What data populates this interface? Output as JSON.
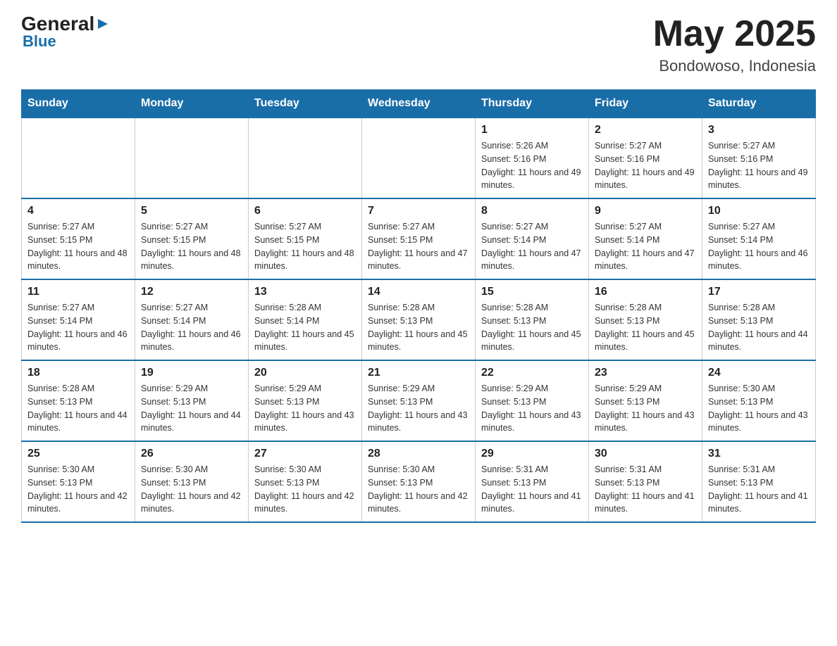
{
  "header": {
    "logo_general": "General",
    "logo_blue": "Blue",
    "month_year": "May 2025",
    "location": "Bondowoso, Indonesia"
  },
  "weekdays": [
    "Sunday",
    "Monday",
    "Tuesday",
    "Wednesday",
    "Thursday",
    "Friday",
    "Saturday"
  ],
  "weeks": [
    [
      {
        "day": "",
        "sunrise": "",
        "sunset": "",
        "daylight": ""
      },
      {
        "day": "",
        "sunrise": "",
        "sunset": "",
        "daylight": ""
      },
      {
        "day": "",
        "sunrise": "",
        "sunset": "",
        "daylight": ""
      },
      {
        "day": "",
        "sunrise": "",
        "sunset": "",
        "daylight": ""
      },
      {
        "day": "1",
        "sunrise": "Sunrise: 5:26 AM",
        "sunset": "Sunset: 5:16 PM",
        "daylight": "Daylight: 11 hours and 49 minutes."
      },
      {
        "day": "2",
        "sunrise": "Sunrise: 5:27 AM",
        "sunset": "Sunset: 5:16 PM",
        "daylight": "Daylight: 11 hours and 49 minutes."
      },
      {
        "day": "3",
        "sunrise": "Sunrise: 5:27 AM",
        "sunset": "Sunset: 5:16 PM",
        "daylight": "Daylight: 11 hours and 49 minutes."
      }
    ],
    [
      {
        "day": "4",
        "sunrise": "Sunrise: 5:27 AM",
        "sunset": "Sunset: 5:15 PM",
        "daylight": "Daylight: 11 hours and 48 minutes."
      },
      {
        "day": "5",
        "sunrise": "Sunrise: 5:27 AM",
        "sunset": "Sunset: 5:15 PM",
        "daylight": "Daylight: 11 hours and 48 minutes."
      },
      {
        "day": "6",
        "sunrise": "Sunrise: 5:27 AM",
        "sunset": "Sunset: 5:15 PM",
        "daylight": "Daylight: 11 hours and 48 minutes."
      },
      {
        "day": "7",
        "sunrise": "Sunrise: 5:27 AM",
        "sunset": "Sunset: 5:15 PM",
        "daylight": "Daylight: 11 hours and 47 minutes."
      },
      {
        "day": "8",
        "sunrise": "Sunrise: 5:27 AM",
        "sunset": "Sunset: 5:14 PM",
        "daylight": "Daylight: 11 hours and 47 minutes."
      },
      {
        "day": "9",
        "sunrise": "Sunrise: 5:27 AM",
        "sunset": "Sunset: 5:14 PM",
        "daylight": "Daylight: 11 hours and 47 minutes."
      },
      {
        "day": "10",
        "sunrise": "Sunrise: 5:27 AM",
        "sunset": "Sunset: 5:14 PM",
        "daylight": "Daylight: 11 hours and 46 minutes."
      }
    ],
    [
      {
        "day": "11",
        "sunrise": "Sunrise: 5:27 AM",
        "sunset": "Sunset: 5:14 PM",
        "daylight": "Daylight: 11 hours and 46 minutes."
      },
      {
        "day": "12",
        "sunrise": "Sunrise: 5:27 AM",
        "sunset": "Sunset: 5:14 PM",
        "daylight": "Daylight: 11 hours and 46 minutes."
      },
      {
        "day": "13",
        "sunrise": "Sunrise: 5:28 AM",
        "sunset": "Sunset: 5:14 PM",
        "daylight": "Daylight: 11 hours and 45 minutes."
      },
      {
        "day": "14",
        "sunrise": "Sunrise: 5:28 AM",
        "sunset": "Sunset: 5:13 PM",
        "daylight": "Daylight: 11 hours and 45 minutes."
      },
      {
        "day": "15",
        "sunrise": "Sunrise: 5:28 AM",
        "sunset": "Sunset: 5:13 PM",
        "daylight": "Daylight: 11 hours and 45 minutes."
      },
      {
        "day": "16",
        "sunrise": "Sunrise: 5:28 AM",
        "sunset": "Sunset: 5:13 PM",
        "daylight": "Daylight: 11 hours and 45 minutes."
      },
      {
        "day": "17",
        "sunrise": "Sunrise: 5:28 AM",
        "sunset": "Sunset: 5:13 PM",
        "daylight": "Daylight: 11 hours and 44 minutes."
      }
    ],
    [
      {
        "day": "18",
        "sunrise": "Sunrise: 5:28 AM",
        "sunset": "Sunset: 5:13 PM",
        "daylight": "Daylight: 11 hours and 44 minutes."
      },
      {
        "day": "19",
        "sunrise": "Sunrise: 5:29 AM",
        "sunset": "Sunset: 5:13 PM",
        "daylight": "Daylight: 11 hours and 44 minutes."
      },
      {
        "day": "20",
        "sunrise": "Sunrise: 5:29 AM",
        "sunset": "Sunset: 5:13 PM",
        "daylight": "Daylight: 11 hours and 43 minutes."
      },
      {
        "day": "21",
        "sunrise": "Sunrise: 5:29 AM",
        "sunset": "Sunset: 5:13 PM",
        "daylight": "Daylight: 11 hours and 43 minutes."
      },
      {
        "day": "22",
        "sunrise": "Sunrise: 5:29 AM",
        "sunset": "Sunset: 5:13 PM",
        "daylight": "Daylight: 11 hours and 43 minutes."
      },
      {
        "day": "23",
        "sunrise": "Sunrise: 5:29 AM",
        "sunset": "Sunset: 5:13 PM",
        "daylight": "Daylight: 11 hours and 43 minutes."
      },
      {
        "day": "24",
        "sunrise": "Sunrise: 5:30 AM",
        "sunset": "Sunset: 5:13 PM",
        "daylight": "Daylight: 11 hours and 43 minutes."
      }
    ],
    [
      {
        "day": "25",
        "sunrise": "Sunrise: 5:30 AM",
        "sunset": "Sunset: 5:13 PM",
        "daylight": "Daylight: 11 hours and 42 minutes."
      },
      {
        "day": "26",
        "sunrise": "Sunrise: 5:30 AM",
        "sunset": "Sunset: 5:13 PM",
        "daylight": "Daylight: 11 hours and 42 minutes."
      },
      {
        "day": "27",
        "sunrise": "Sunrise: 5:30 AM",
        "sunset": "Sunset: 5:13 PM",
        "daylight": "Daylight: 11 hours and 42 minutes."
      },
      {
        "day": "28",
        "sunrise": "Sunrise: 5:30 AM",
        "sunset": "Sunset: 5:13 PM",
        "daylight": "Daylight: 11 hours and 42 minutes."
      },
      {
        "day": "29",
        "sunrise": "Sunrise: 5:31 AM",
        "sunset": "Sunset: 5:13 PM",
        "daylight": "Daylight: 11 hours and 41 minutes."
      },
      {
        "day": "30",
        "sunrise": "Sunrise: 5:31 AM",
        "sunset": "Sunset: 5:13 PM",
        "daylight": "Daylight: 11 hours and 41 minutes."
      },
      {
        "day": "31",
        "sunrise": "Sunrise: 5:31 AM",
        "sunset": "Sunset: 5:13 PM",
        "daylight": "Daylight: 11 hours and 41 minutes."
      }
    ]
  ]
}
